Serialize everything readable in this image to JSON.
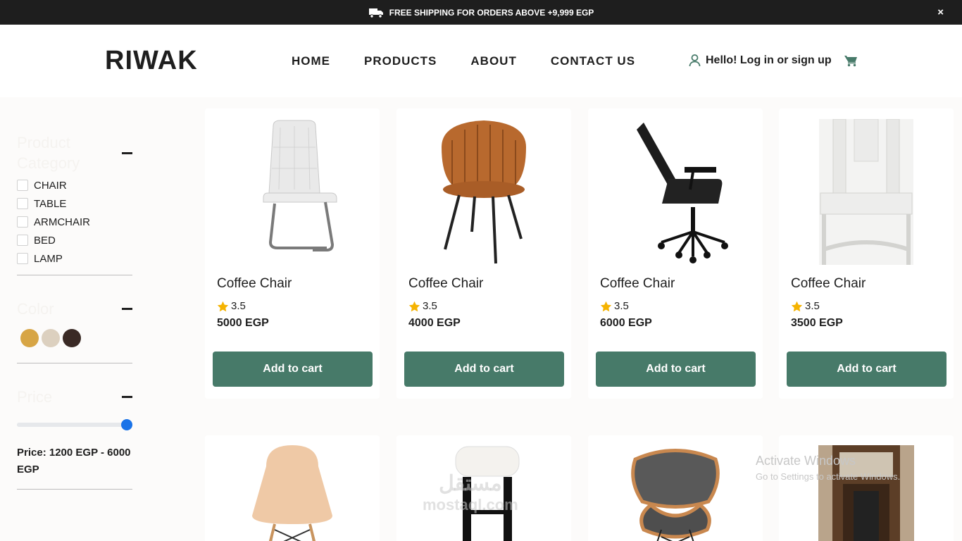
{
  "announcement": {
    "text": "FREE SHIPPING FOR ORDERS ABOVE +9,999 EGP",
    "close": "×"
  },
  "header": {
    "logo": "RIWAK",
    "nav": [
      "HOME",
      "PRODUCTS",
      "ABOUT",
      "CONTACT US"
    ],
    "account_label": "Hello! Log in or sign up"
  },
  "filters": {
    "category_title": "Product Category",
    "categories": [
      "CHAIR",
      "TABLE",
      "ARMCHAIR",
      "BED",
      "LAMP"
    ],
    "color_title": "Color",
    "colors": [
      "#d7a545",
      "#dcd0bf",
      "#3a2a25"
    ],
    "price_title": "Price",
    "price_slider_value": 1.0,
    "price_text": "Price: 1200 EGP - 6000 EGP"
  },
  "products": [
    {
      "name": "Coffee Chair",
      "rating": "3.5",
      "price": "5000 EGP",
      "button": "Add to cart"
    },
    {
      "name": "Coffee Chair",
      "rating": "3.5",
      "price": "4000 EGP",
      "button": "Add to cart"
    },
    {
      "name": "Coffee Chair",
      "rating": "3.5",
      "price": "6000 EGP",
      "button": "Add to cart"
    },
    {
      "name": "Coffee Chair",
      "rating": "3.5",
      "price": "3500 EGP",
      "button": "Add to cart"
    }
  ],
  "watermark": {
    "line1": "Activate Windows",
    "line2": "Go to Settings to activate Windows.",
    "site_ar": "مستقل",
    "site": "mostaql.com"
  },
  "colors": {
    "accent": "#477a69",
    "star": "#f5b301",
    "topbar": "#1e1e1e",
    "slider_thumb": "#1a73e8"
  }
}
